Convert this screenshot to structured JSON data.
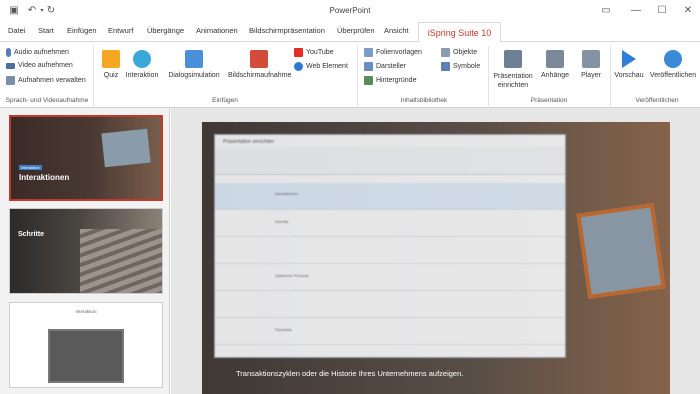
{
  "app": {
    "title": "PowerPoint"
  },
  "tabs": [
    "Datei",
    "Start",
    "Einfügen",
    "Entwurf",
    "Übergänge",
    "Animationen",
    "Bildschirmpräsentation",
    "Überprüfen",
    "Ansicht"
  ],
  "active_tab": "iSpring Suite 10",
  "ribbon": {
    "narration": {
      "items": [
        "Audio aufnehmen",
        "Video aufnehmen",
        "Aufnahmen verwalten"
      ],
      "label": "Sprach- und Videoaufnahme"
    },
    "insert": {
      "buttons": [
        "Quiz",
        "Interaktion",
        "Dialogsimulation",
        "Bildschirmaufnahme"
      ],
      "small": [
        "YouTube",
        "Web Element"
      ],
      "label": "Einfügen"
    },
    "library": {
      "col1": [
        "Folienvorlagen",
        "Darsteller",
        "Hintergründe"
      ],
      "col2": [
        "Objekte",
        "Symbole"
      ],
      "label": "Inhaltsbibliothek"
    },
    "presentation": {
      "buttons": [
        "Präsentation einrichten",
        "Anhänge",
        "Player"
      ],
      "label": "Präsentation"
    },
    "publish": {
      "buttons": [
        "Vorschau",
        "Veröffentlichen"
      ],
      "label": "Veröffentlichen"
    }
  },
  "thumbs": [
    {
      "title": "Interaktionen",
      "tag": "Interaktion"
    },
    {
      "title": "Schritte"
    },
    {
      "title": "Interaktion"
    }
  ],
  "dialog": {
    "title": "Präsentation einrichten",
    "rows": [
      "Interaktionen",
      "Schritte",
      "Zyklischer Prozess",
      "Pyramide"
    ]
  },
  "slide": {
    "caption": "Transaktionszyklen oder die Historie Ihres Unternehmens aufzeigen."
  },
  "colors": {
    "accent": "#c0392b",
    "ribbon_bg": "#ffffff"
  }
}
